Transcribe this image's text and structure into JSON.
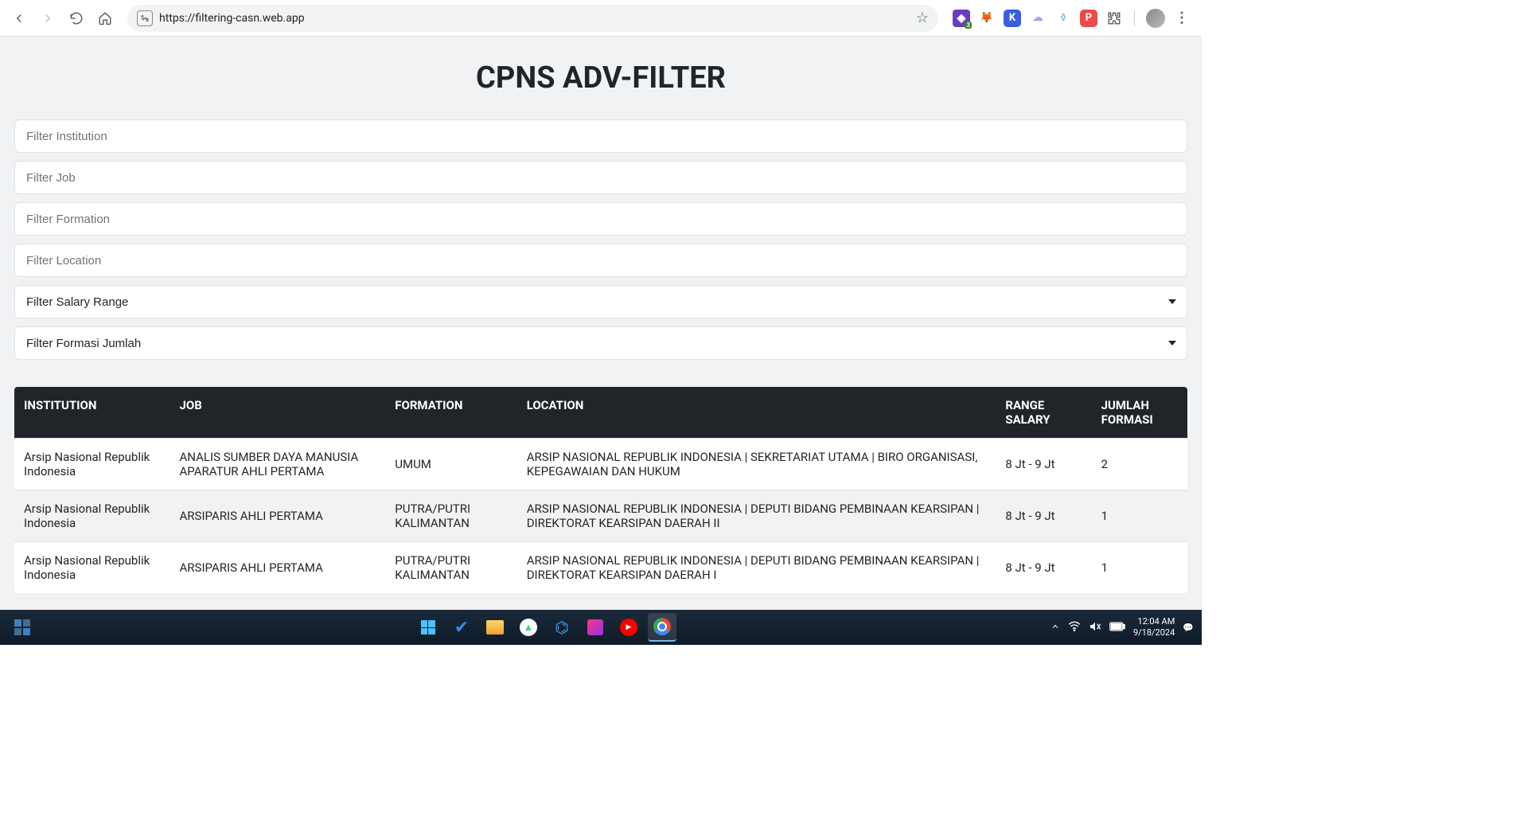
{
  "browser": {
    "url": "https://filtering-casn.web.app"
  },
  "page": {
    "title": "CPNS ADV-FILTER",
    "filters": {
      "institution_ph": "Filter Institution",
      "job_ph": "Filter Job",
      "formation_ph": "Filter Formation",
      "location_ph": "Filter Location",
      "salary_label": "Filter Salary Range",
      "jumlah_label": "Filter Formasi Jumlah"
    },
    "table": {
      "headers": {
        "institution": "INSTITUTION",
        "job": "JOB",
        "formation": "FORMATION",
        "location": "LOCATION",
        "salary": "RANGE SALARY",
        "jumlah": "JUMLAH FORMASI"
      },
      "rows": [
        {
          "institution": "Arsip Nasional Republik Indonesia",
          "job": "ANALIS SUMBER DAYA MANUSIA APARATUR AHLI PERTAMA",
          "formation": "UMUM",
          "location": "ARSIP NASIONAL REPUBLIK INDONESIA | SEKRETARIAT UTAMA | BIRO ORGANISASI, KEPEGAWAIAN DAN HUKUM",
          "salary": "8 Jt - 9 Jt",
          "jumlah": "2"
        },
        {
          "institution": "Arsip Nasional Republik Indonesia",
          "job": "ARSIPARIS AHLI PERTAMA",
          "formation": "PUTRA/PUTRI KALIMANTAN",
          "location": "ARSIP NASIONAL REPUBLIK INDONESIA | DEPUTI BIDANG PEMBINAAN KEARSIPAN | DIREKTORAT KEARSIPAN DAERAH II",
          "salary": "8 Jt - 9 Jt",
          "jumlah": "1"
        },
        {
          "institution": "Arsip Nasional Republik Indonesia",
          "job": "ARSIPARIS AHLI PERTAMA",
          "formation": "PUTRA/PUTRI KALIMANTAN",
          "location": "ARSIP NASIONAL REPUBLIK INDONESIA | DEPUTI BIDANG PEMBINAAN KEARSIPAN | DIREKTORAT KEARSIPAN DAERAH I",
          "salary": "8 Jt - 9 Jt",
          "jumlah": "1"
        }
      ]
    }
  },
  "taskbar": {
    "time": "12:04 AM",
    "date": "9/18/2024"
  }
}
